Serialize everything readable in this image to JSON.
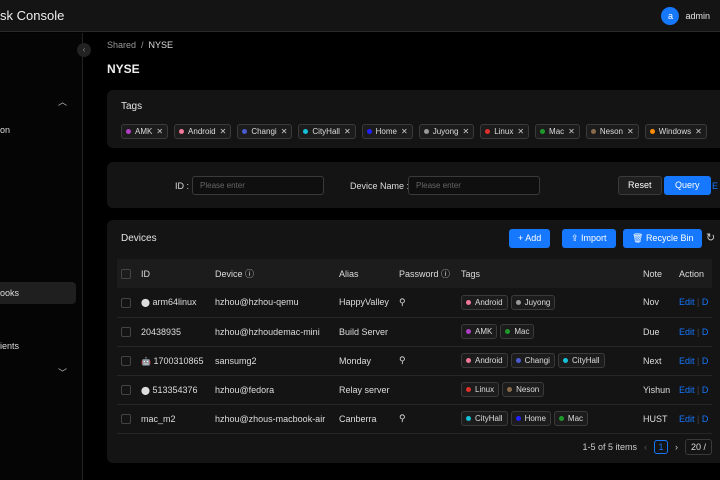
{
  "header": {
    "title": "sk Console",
    "avatar": "a",
    "user": "admin"
  },
  "sidebar": {
    "items": [
      "on",
      "ooks",
      "ients"
    ]
  },
  "breadcrumb": {
    "parent": "Shared",
    "current": "NYSE"
  },
  "page_title": "NYSE",
  "tags": {
    "title": "Tags",
    "items": [
      {
        "name": "AMK",
        "color": "#b03fc4"
      },
      {
        "name": "Android",
        "color": "#f0799a"
      },
      {
        "name": "Changi",
        "color": "#4a5bd0"
      },
      {
        "name": "CityHall",
        "color": "#16c0d8"
      },
      {
        "name": "Home",
        "color": "#2020ff"
      },
      {
        "name": "Juyong",
        "color": "#999999"
      },
      {
        "name": "Linux",
        "color": "#e0302a"
      },
      {
        "name": "Mac",
        "color": "#1f9a2a"
      },
      {
        "name": "Neson",
        "color": "#8a6a4a"
      },
      {
        "name": "Windows",
        "color": "#ff8c00"
      }
    ]
  },
  "search": {
    "id_label": "ID",
    "id_placeholder": "Please enter",
    "name_label": "Device Name",
    "name_placeholder": "Please enter",
    "reset": "Reset",
    "query": "Query",
    "extra": "E"
  },
  "devices": {
    "title": "Devices",
    "add": "+ Add",
    "import": "Import",
    "recycle": "Recycle Bin",
    "columns": [
      "ID",
      "Device",
      "Alias",
      "Password",
      "Tags",
      "Note",
      "Action"
    ],
    "rows": [
      {
        "os": "linux",
        "id": "arm64linux",
        "device": "hzhou@hzhou-qemu",
        "alias": "HappyValley",
        "pw": true,
        "tags": [
          "Android",
          "Juyong"
        ],
        "note": "Nov"
      },
      {
        "os": "mac",
        "id": "20438935",
        "device": "hzhou@hzhoudemac-mini",
        "alias": "Build Server",
        "pw": false,
        "tags": [
          "AMK",
          "Mac"
        ],
        "note": "Due"
      },
      {
        "os": "android",
        "id": "1700310865",
        "device": "sansumg2",
        "alias": "Monday",
        "pw": true,
        "tags": [
          "Android",
          "Changi",
          "CityHall"
        ],
        "note": "Next"
      },
      {
        "os": "linux",
        "id": "513354376",
        "device": "hzhou@fedora",
        "alias": "Relay server",
        "pw": false,
        "tags": [
          "Linux",
          "Neson"
        ],
        "note": "Yishun"
      },
      {
        "os": "mac",
        "id": "mac_m2",
        "device": "hzhou@zhous-macbook-air",
        "alias": "Canberra",
        "pw": true,
        "tags": [
          "CityHall",
          "Home",
          "Mac"
        ],
        "note": "HUST"
      }
    ],
    "edit": "Edit",
    "delete": "D",
    "pagination": {
      "summary": "1-5 of 5 items",
      "page": "1",
      "size": "20 /"
    }
  }
}
